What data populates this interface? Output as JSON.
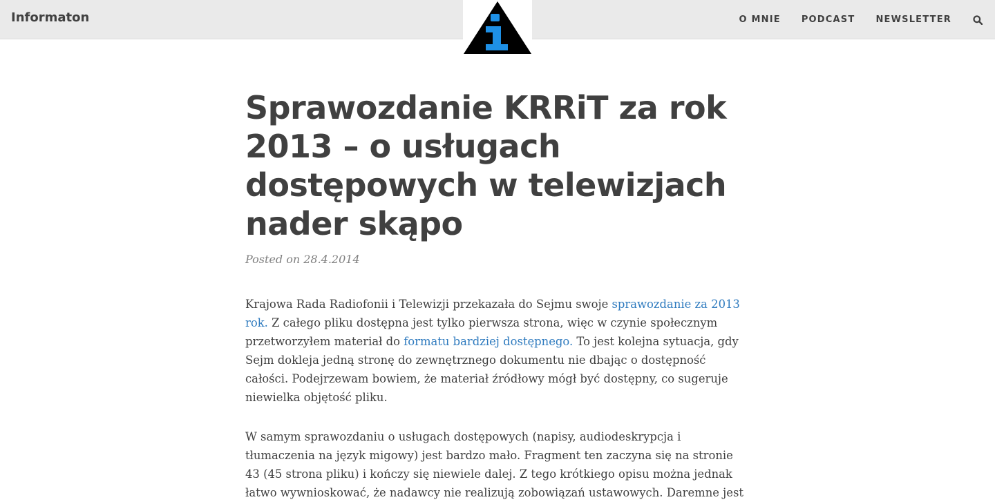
{
  "header": {
    "brand": "Informaton",
    "nav": [
      "O MNIE",
      "PODCAST",
      "NEWSLETTER"
    ],
    "search_icon": "search-icon",
    "logo_icon": "info-triangle-logo",
    "colors": {
      "bar": "#eaeaea",
      "logo_accent": "#1e90e6"
    }
  },
  "article": {
    "title": "Sprawozdanie KRRiT za rok 2013 – o usługach dostępowych w telewizjach nader skąpo",
    "meta": "Posted on 28.4.2014",
    "p1": {
      "t1": "Krajowa Rada Radiofonii i Telewizji przekazała do Sejmu swoje ",
      "link1": "sprawozdanie za 2013 rok.",
      "t2": " Z całego pliku dostępna jest tylko pierwsza strona, więc w czynie społecznym przetworzyłem materiał do ",
      "link2": "formatu bardziej dostępnego.",
      "t3": " To jest kolejna sytuacja, gdy Sejm dokleja jedną stronę do zewnętrznego dokumentu nie dbając o dostępność całości. Podejrzewam bowiem, że materiał źródłowy mógł być dostępny, co sugeruje niewielka objętość pliku."
    },
    "p2": "W samym sprawozdaniu o usługach dostępowych (napisy, audiodeskrypcja i tłumaczenia na język migowy) jest bardzo mało. Fragment ten zaczyna się na stronie 43 (45 strona pliku) i kończy się niewiele dalej. Z tego krótkiego opisu można jednak łatwo wywnioskować, że nadawcy nie realizują zobowiązań ustawowych. Daremne jest",
    "link_color": "#2f7bbf"
  }
}
